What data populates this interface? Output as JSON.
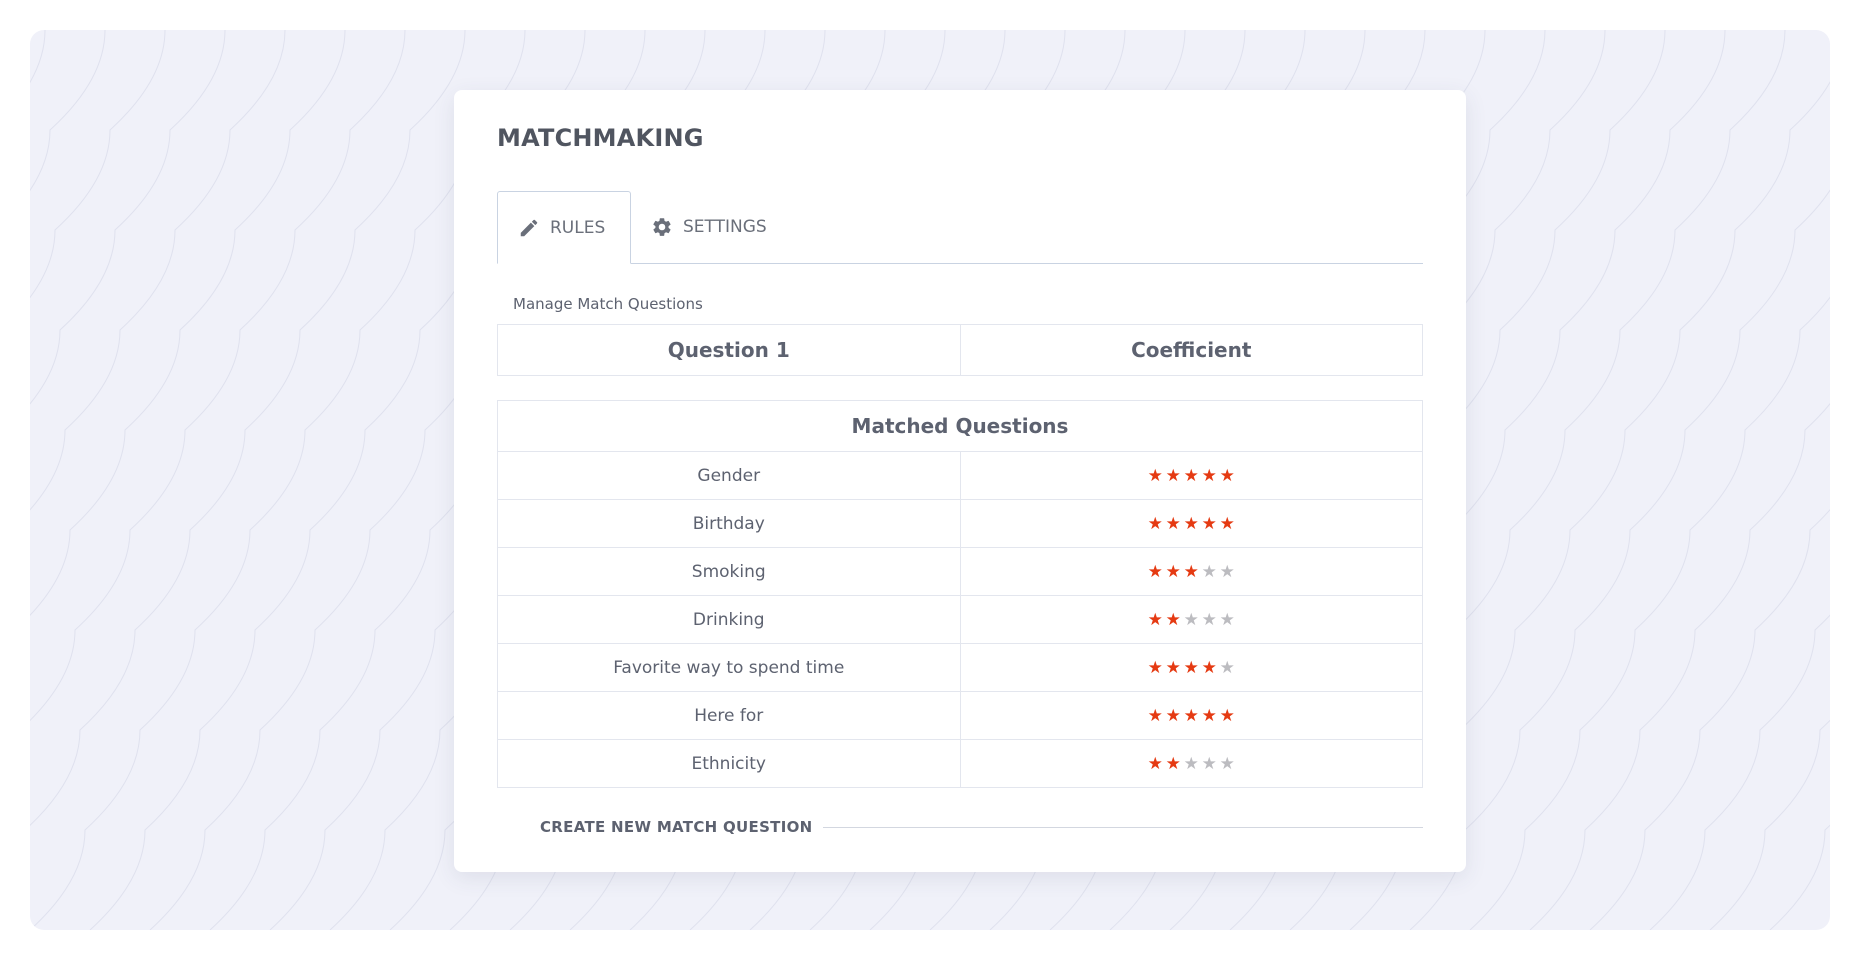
{
  "page": {
    "title": "MATCHMAKING"
  },
  "tabs": [
    {
      "label": "RULES",
      "icon": "pencil-icon",
      "active": true
    },
    {
      "label": "SETTINGS",
      "icon": "gear-icon",
      "active": false
    }
  ],
  "manage": {
    "label": "Manage Match Questions"
  },
  "header_table": {
    "columns": [
      "Question 1",
      "Coefficient"
    ]
  },
  "matched": {
    "title": "Matched Questions",
    "rows": [
      {
        "question": "Gender",
        "rating": 5
      },
      {
        "question": "Birthday",
        "rating": 5
      },
      {
        "question": "Smoking",
        "rating": 3
      },
      {
        "question": "Drinking",
        "rating": 2
      },
      {
        "question": "Favorite way to spend time",
        "rating": 4
      },
      {
        "question": "Here for",
        "rating": 5
      },
      {
        "question": "Ethnicity",
        "rating": 2
      }
    ],
    "max_rating": 5
  },
  "actions": {
    "create_label": "CREATE NEW MATCH QUESTION"
  },
  "colors": {
    "star_on": "#e53a12",
    "star_off": "#bcbcc0",
    "background": "#f0f1f9"
  }
}
